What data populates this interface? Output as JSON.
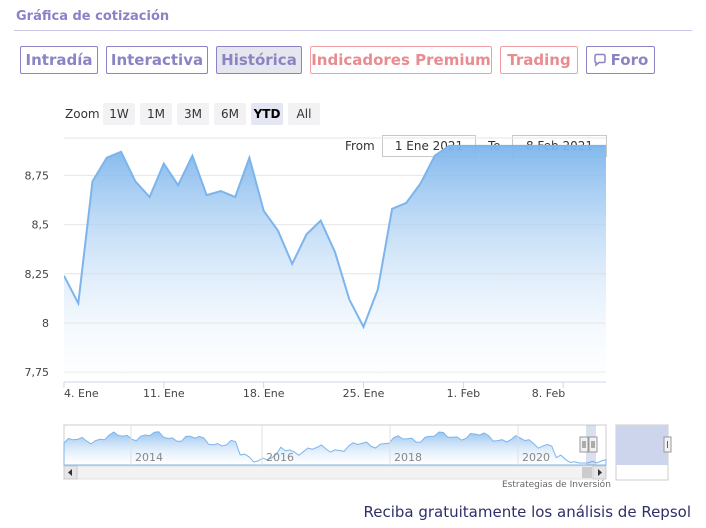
{
  "header": {
    "title": "Gráfica de cotización"
  },
  "tabs": [
    {
      "label": "Intradía",
      "active": false,
      "premium": false
    },
    {
      "label": "Interactiva",
      "active": false,
      "premium": false
    },
    {
      "label": "Histórica",
      "active": true,
      "premium": false
    },
    {
      "label": "Indicadores Premium",
      "active": false,
      "premium": true
    },
    {
      "label": "Trading",
      "active": false,
      "premium": true
    },
    {
      "label": "Foro",
      "active": false,
      "premium": false,
      "icon": "chat-bubble-icon"
    }
  ],
  "zoom": {
    "label": "Zoom",
    "options": [
      "1W",
      "1M",
      "3M",
      "6M",
      "YTD",
      "All"
    ],
    "selected": "YTD"
  },
  "range": {
    "from_label": "From",
    "from_value": "1 Ene 2021",
    "to_label": "To",
    "to_value": "8 Feb 2021"
  },
  "chart_data": {
    "type": "area",
    "x_ticks": [
      "4. Ene",
      "11. Ene",
      "18. Ene",
      "25. Ene",
      "1. Feb",
      "8. Feb"
    ],
    "y_ticks": [
      "7,75",
      "8",
      "8,25",
      "8,5",
      "8,75"
    ],
    "ylim": [
      7.7,
      8.94
    ],
    "grid": true,
    "x": [
      0,
      1,
      2,
      3,
      4,
      5,
      6,
      7,
      8,
      9,
      10,
      11,
      12,
      13,
      14,
      15,
      16,
      17,
      18,
      19,
      20,
      21,
      22,
      23,
      24,
      25,
      26,
      27,
      28,
      29,
      30,
      31,
      32,
      33,
      34,
      35,
      36,
      37,
      38
    ],
    "values": [
      8.24,
      8.1,
      8.72,
      8.84,
      8.87,
      8.72,
      8.64,
      8.81,
      8.7,
      8.85,
      8.65,
      8.67,
      8.64,
      8.84,
      8.57,
      8.47,
      8.3,
      8.45,
      8.52,
      8.36,
      8.12,
      7.98,
      8.17,
      8.58,
      8.61,
      8.71,
      8.85,
      8.9,
      8.9,
      8.9,
      8.9,
      8.9,
      8.9,
      8.9,
      8.9,
      8.9,
      8.9,
      8.9,
      8.9
    ],
    "tick_positions": [
      0,
      7,
      14,
      21,
      28,
      35
    ],
    "navigator": {
      "labels": [
        "2014",
        "2016",
        "2018",
        "2020"
      ]
    },
    "credit": "Estrategias de Inversión",
    "colors": {
      "line": "#7cb5ec",
      "fill_top": "#7cb5ec",
      "fill_bottom": "#ffffff",
      "grid": "#e6e6e6"
    }
  },
  "footer": {
    "note": "Reciba gratuitamente los análisis de Repsol"
  }
}
